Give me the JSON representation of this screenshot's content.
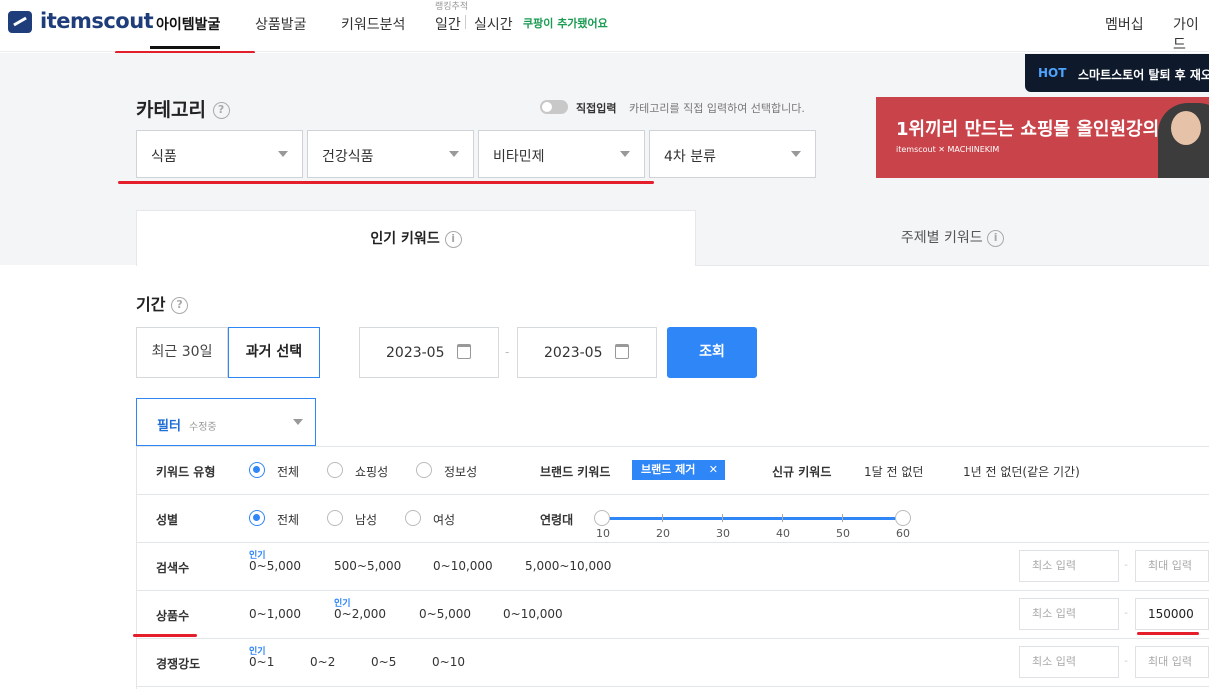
{
  "header": {
    "logo": "itemscout",
    "nav": [
      "아이템발굴",
      "상품발굴",
      "키워드분석",
      "일간",
      "실시간"
    ],
    "ranking_label": "랭킹추적",
    "coupang_note": "쿠팡이 추가됐어요",
    "right": [
      "멤버십",
      "가이드"
    ]
  },
  "hot": {
    "tag": "HOT",
    "text": "스마트스토어 탈퇴 후 재오"
  },
  "category": {
    "title": "카테고리",
    "toggle_label": "직접입력",
    "toggle_desc": "카테고리를 직접 입력하여 선택합니다.",
    "selects": [
      "식품",
      "건강식품",
      "비타민제",
      "4차 분류"
    ]
  },
  "banner": {
    "headline": "1위끼리 만드는 쇼핑몰 올인원강의",
    "sub": "itemscout  ✕  MACHINEKIM"
  },
  "tabs": [
    "인기 키워드",
    "주제별 키워드"
  ],
  "period": {
    "title": "기간",
    "recent": "최근 30일",
    "past": "과거 선택",
    "start": "2023-05",
    "end": "2023-05",
    "dash": "-",
    "search": "조회"
  },
  "filter": {
    "label": "필터",
    "state": "수정중"
  },
  "rows": {
    "keyword_type": {
      "label": "키워드 유형",
      "options": [
        "전체",
        "쇼핑성",
        "정보성"
      ]
    },
    "brand": {
      "label": "브랜드 키워드",
      "chip": "브랜드 제거",
      "chip_x": "✕"
    },
    "new": {
      "label": "신규 키워드",
      "options": [
        "1달 전 없던",
        "1년 전 없던(같은 기간)"
      ]
    },
    "gender": {
      "label": "성별",
      "options": [
        "전체",
        "남성",
        "여성"
      ]
    },
    "age": {
      "label": "연령대",
      "ticks": [
        "10",
        "20",
        "30",
        "40",
        "50",
        "60"
      ],
      "range": [
        10,
        60
      ]
    },
    "search_count": {
      "label": "검색수",
      "popular": "인기",
      "options": [
        "0~5,000",
        "500~5,000",
        "0~10,000",
        "5,000~10,000"
      ],
      "min": "최소 입력",
      "max": "최대 입력"
    },
    "product_count": {
      "label": "상품수",
      "popular": "인기",
      "options": [
        "0~1,000",
        "0~2,000",
        "0~5,000",
        "0~10,000"
      ],
      "min": "최소 입력",
      "max": "150000"
    },
    "competition": {
      "label": "경쟁강도",
      "popular": "인기",
      "options": [
        "0~1",
        "0~2",
        "0~5",
        "0~10"
      ],
      "min": "최소 입력",
      "max": "최대 입력"
    }
  },
  "colors": {
    "accent": "#2f86f6",
    "brand": "#1f3d7a",
    "annotation": "#e51e2b"
  }
}
